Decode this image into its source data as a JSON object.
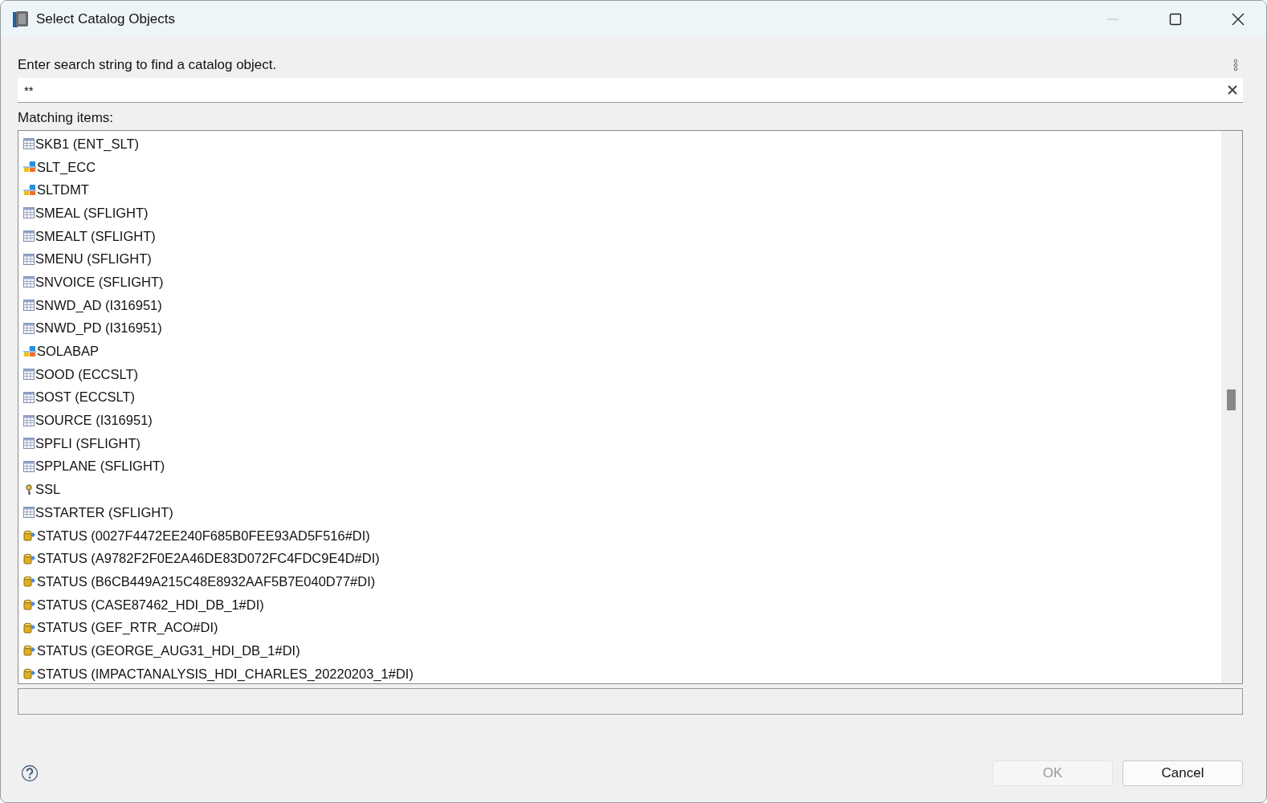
{
  "window": {
    "title": "Select Catalog Objects"
  },
  "search": {
    "label": "Enter search string to find a catalog object.",
    "value": "**"
  },
  "list": {
    "label": "Matching items:",
    "items": [
      {
        "kind": "table",
        "text": "SKB1 (ENT_SLT)"
      },
      {
        "kind": "package",
        "text": "SLT_ECC"
      },
      {
        "kind": "package",
        "text": "SLTDMT"
      },
      {
        "kind": "table",
        "text": "SMEAL (SFLIGHT)"
      },
      {
        "kind": "table",
        "text": "SMEALT (SFLIGHT)"
      },
      {
        "kind": "table",
        "text": "SMENU (SFLIGHT)"
      },
      {
        "kind": "table",
        "text": "SNVOICE (SFLIGHT)"
      },
      {
        "kind": "table",
        "text": "SNWD_AD (I316951)"
      },
      {
        "kind": "table",
        "text": "SNWD_PD (I316951)"
      },
      {
        "kind": "package",
        "text": "SOLABAP"
      },
      {
        "kind": "table",
        "text": "SOOD (ECCSLT)"
      },
      {
        "kind": "table",
        "text": "SOST (ECCSLT)"
      },
      {
        "kind": "table",
        "text": "SOURCE (I316951)"
      },
      {
        "kind": "table",
        "text": "SPFLI (SFLIGHT)"
      },
      {
        "kind": "table",
        "text": "SPPLANE (SFLIGHT)"
      },
      {
        "kind": "key",
        "text": "SSL"
      },
      {
        "kind": "table",
        "text": "SSTARTER (SFLIGHT)"
      },
      {
        "kind": "container",
        "text": "STATUS (0027F4472EE240F685B0FEE93AD5F516#DI)"
      },
      {
        "kind": "container",
        "text": "STATUS (A9782F2F0E2A46DE83D072FC4FDC9E4D#DI)"
      },
      {
        "kind": "container",
        "text": "STATUS (B6CB449A215C48E8932AAF5B7E040D77#DI)"
      },
      {
        "kind": "container",
        "text": "STATUS (CASE87462_HDI_DB_1#DI)"
      },
      {
        "kind": "container",
        "text": "STATUS (GEF_RTR_ACO#DI)"
      },
      {
        "kind": "container",
        "text": "STATUS (GEORGE_AUG31_HDI_DB_1#DI)"
      },
      {
        "kind": "container",
        "text": "STATUS (IMPACTANALYSIS_HDI_CHARLES_20220203_1#DI)"
      }
    ]
  },
  "buttons": [
    {
      "label": "OK",
      "disabled": true
    },
    {
      "label": "Cancel",
      "disabled": false
    }
  ]
}
